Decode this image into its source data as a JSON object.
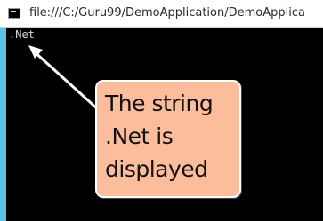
{
  "window": {
    "title": "file:///C:/Guru99/DemoApplication/DemoApplica",
    "icon": "console-app-icon"
  },
  "console": {
    "output": ".Net"
  },
  "annotation": {
    "text_line1": "The string",
    "text_line2": ".Net is",
    "text_line3": "displayed",
    "background_color": "#fbbd9b",
    "arrow_color": "#ffffff"
  }
}
